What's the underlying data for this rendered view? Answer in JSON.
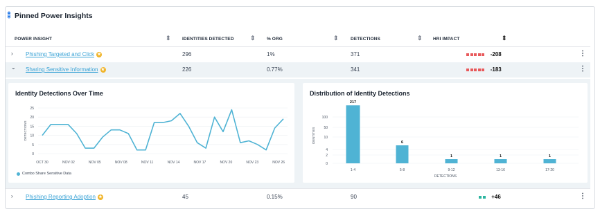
{
  "title": "Pinned Power Insights",
  "columns": {
    "insight": "POWER INSIGHT",
    "identities": "IDENTITIES DETECTED",
    "org": "% ORG",
    "detections": "DETECTIONS",
    "hri": "HRI IMPACT"
  },
  "rows": [
    {
      "name": "Phishing Targeted and Click",
      "identities": "296",
      "org": "1%",
      "detections": "371",
      "impact": "-208",
      "impact_color": "#e8595b",
      "impact_squares": 5,
      "caret": "›"
    },
    {
      "name": "Sharing Sensitive Information",
      "identities": "226",
      "org": "0.77%",
      "detections": "341",
      "impact": "-183",
      "impact_color": "#e8595b",
      "impact_squares": 5,
      "caret": "⌄"
    },
    {
      "name": "Phishing Reporting Adoption",
      "identities": "45",
      "org": "0.15%",
      "detections": "90",
      "impact": "+46",
      "impact_color": "#2cb5a0",
      "impact_squares": 2,
      "caret": "›"
    }
  ],
  "chart_data": [
    {
      "type": "line",
      "title": "Identity Detections Over Time",
      "ylabel": "DETECTIONS",
      "ylim": [
        0,
        25
      ],
      "yticks": [
        "0",
        "5",
        "10",
        "15",
        "20",
        "25"
      ],
      "xticks": [
        "OCT 30",
        "NOV 02",
        "NOV 05",
        "NOV 08",
        "NOV 11",
        "NOV 14",
        "NOV 17",
        "NOV 20",
        "NOV 23",
        "NOV 26"
      ],
      "series": [
        {
          "name": "Combo Share Sensitive Data",
          "values": [
            10,
            16,
            16,
            16,
            11,
            3,
            3,
            9,
            13,
            13,
            11,
            2,
            2,
            17,
            17,
            18,
            22,
            15,
            6,
            3,
            20,
            12,
            24,
            6,
            7,
            5,
            2,
            14,
            19
          ]
        }
      ],
      "color": "#4fb3d4"
    },
    {
      "type": "bar",
      "title": "Distribution of Identity Detections",
      "xlabel": "DETECTIONS",
      "ylabel": "IDENTITIES",
      "yscale": "log",
      "yticks": [
        "0",
        "2",
        "4",
        "10",
        "50",
        "100"
      ],
      "categories": [
        "1-4",
        "5-8",
        "9-12",
        "13-16",
        "17-20"
      ],
      "values": [
        217,
        6,
        1,
        1,
        1
      ],
      "color": "#4fb3d4"
    }
  ]
}
